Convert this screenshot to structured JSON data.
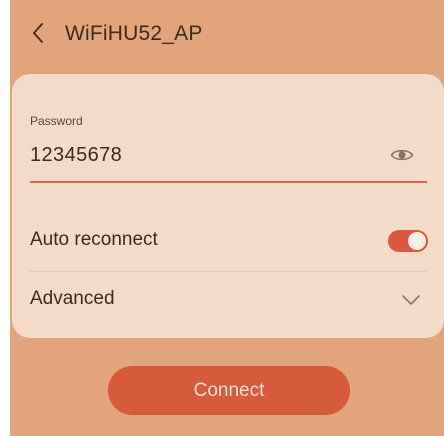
{
  "header": {
    "title": "WiFiHU52_AP",
    "back_icon": "chevron-left-icon"
  },
  "password": {
    "label": "Password",
    "value": "12345678",
    "visibility_icon": "eye-icon"
  },
  "auto_reconnect": {
    "label": "Auto reconnect",
    "enabled": true
  },
  "advanced": {
    "label": "Advanced",
    "icon": "chevron-down-icon"
  },
  "actions": {
    "connect_label": "Connect"
  },
  "colors": {
    "background": "#e2a47b",
    "card": "#f3dbc8",
    "accent": "#d65a3c",
    "text": "#3e2a1e"
  }
}
